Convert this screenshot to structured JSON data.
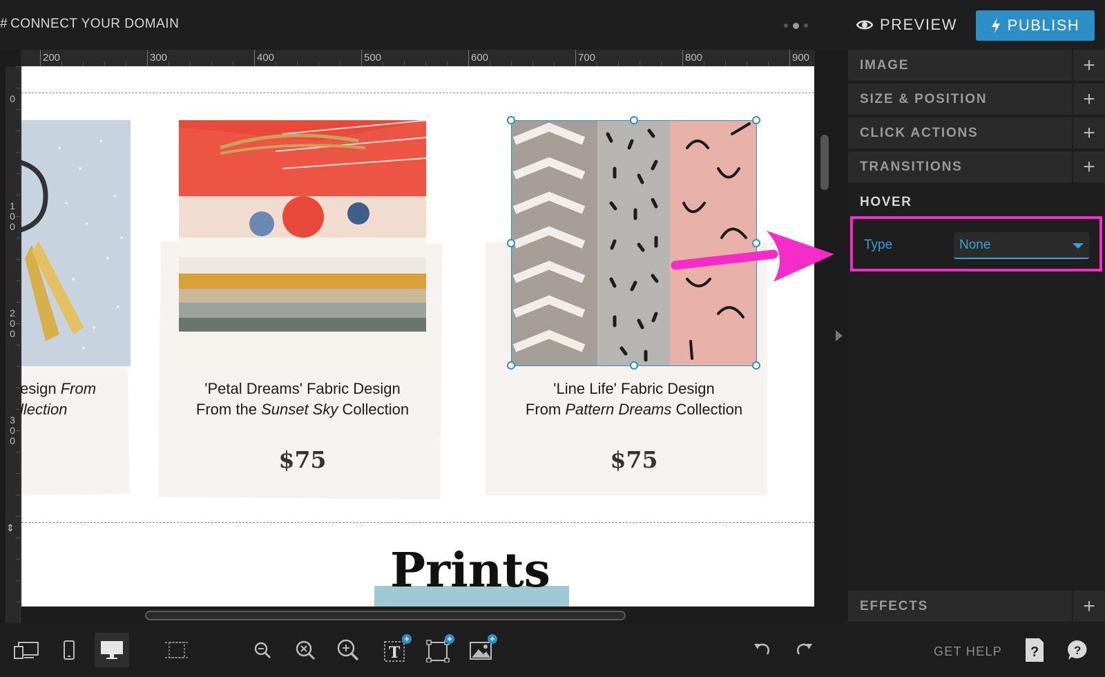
{
  "topbar": {
    "connect_label": "CONNECT YOUR DOMAIN",
    "preview_label": "PREVIEW",
    "publish_label": "PUBLISH"
  },
  "ruler": {
    "top_labels": [
      "200",
      "300",
      "400",
      "500",
      "600",
      "700",
      "800",
      "900"
    ],
    "left_labels": [
      "0",
      "100",
      "200",
      "300"
    ]
  },
  "canvas": {
    "cards": [
      {
        "caption_line1_pre": "esign ",
        "caption_line1_italic": "From",
        "caption_line2_italic": "llection"
      },
      {
        "caption_line1": "'Petal Dreams' Fabric Design",
        "caption_line2_pre": "From the ",
        "caption_line2_italic": "Sunset Sky",
        "caption_line2_post": " Collection",
        "price": "$75"
      },
      {
        "caption_line1": "'Line Life' Fabric Design",
        "caption_line2_pre": "From ",
        "caption_line2_italic": "Pattern Dreams",
        "caption_line2_post": " Collection",
        "price": "$75"
      }
    ],
    "section_heading": "Prints"
  },
  "panel": {
    "sections": [
      "IMAGE",
      "SIZE & POSITION",
      "CLICK ACTIONS",
      "TRANSITIONS"
    ],
    "hover_title": "HOVER",
    "type_label": "Type",
    "type_value": "None",
    "effects_label": "EFFECTS",
    "plus_symbol": "+"
  },
  "bottombar": {
    "get_help_label": "GET HELP",
    "help_glyph": "?"
  },
  "colors": {
    "accent_blue": "#2c8fc7",
    "highlight_magenta": "#f52cc7",
    "selection_blue": "#2d8fd2"
  }
}
